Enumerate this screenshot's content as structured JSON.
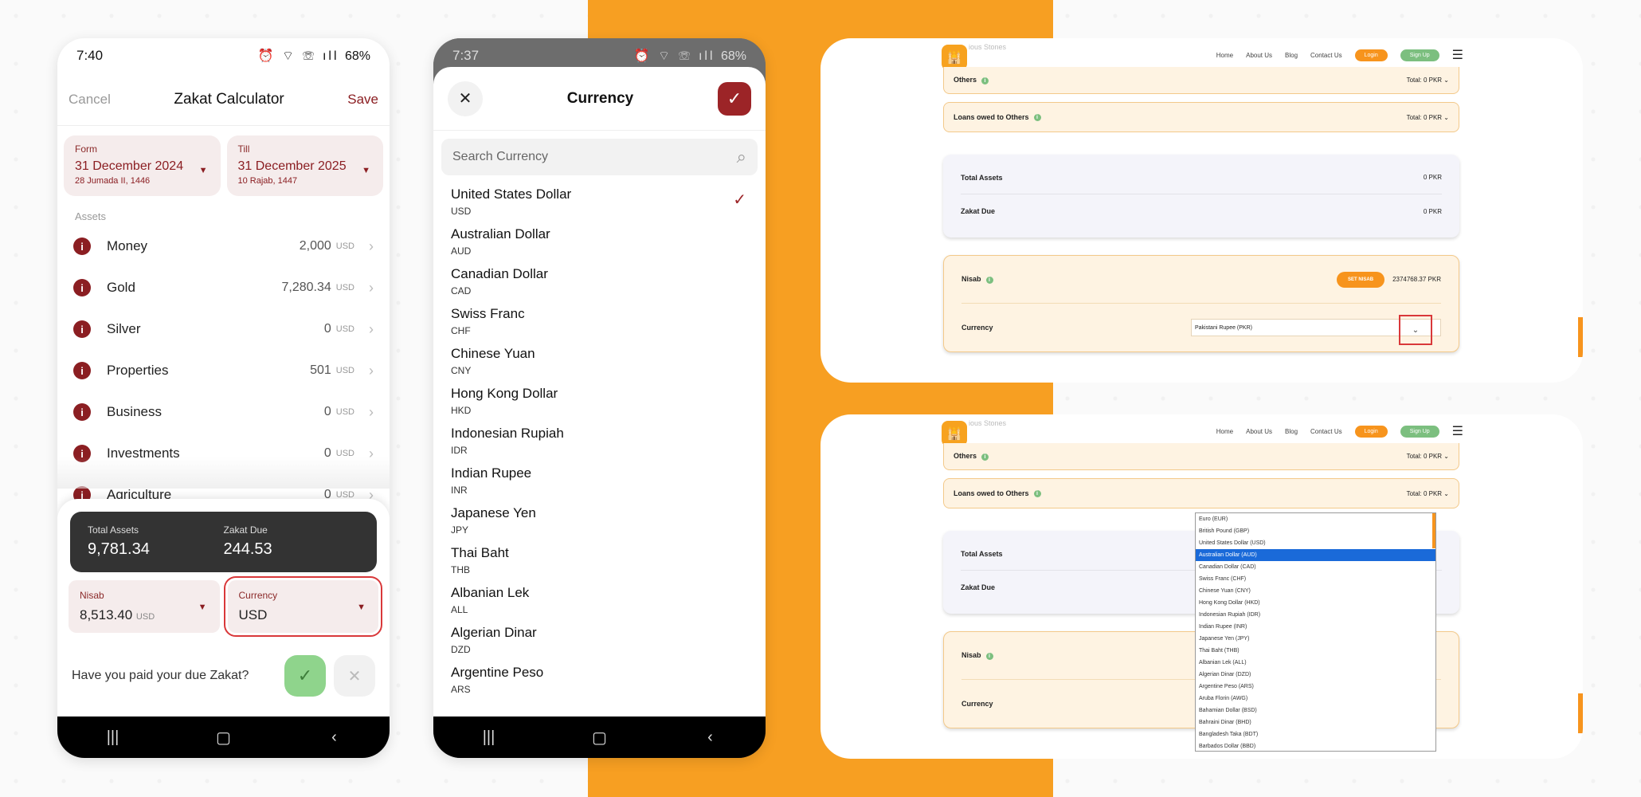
{
  "phone1": {
    "status": {
      "time": "7:40",
      "battery": "68%"
    },
    "header": {
      "cancel": "Cancel",
      "title": "Zakat Calculator",
      "save": "Save"
    },
    "from": {
      "label": "Form",
      "date": "31 December 2024",
      "hijri": "28 Jumada II, 1446"
    },
    "till": {
      "label": "Till",
      "date": "31 December 2025",
      "hijri": "10 Rajab, 1447"
    },
    "assets_label": "Assets",
    "assets": [
      {
        "name": "Money",
        "value": "2,000",
        "cur": "USD"
      },
      {
        "name": "Gold",
        "value": "7,280.34",
        "cur": "USD"
      },
      {
        "name": "Silver",
        "value": "0",
        "cur": "USD"
      },
      {
        "name": "Properties",
        "value": "501",
        "cur": "USD"
      },
      {
        "name": "Business",
        "value": "0",
        "cur": "USD"
      },
      {
        "name": "Investments",
        "value": "0",
        "cur": "USD"
      },
      {
        "name": "Agriculture",
        "value": "0",
        "cur": "USD"
      }
    ],
    "total_assets": {
      "label": "Total Assets",
      "value": "9,781.34"
    },
    "zakat_due": {
      "label": "Zakat Due",
      "value": "244.53"
    },
    "nisab": {
      "label": "Nisab",
      "value": "8,513.40",
      "cur": "USD"
    },
    "currency": {
      "label": "Currency",
      "value": "USD"
    },
    "question": "Have you paid your due Zakat?"
  },
  "phone2": {
    "status": {
      "time": "7:37",
      "battery": "68%"
    },
    "title": "Currency",
    "search_placeholder": "Search Currency",
    "currencies": [
      {
        "name": "United States Dollar",
        "code": "USD",
        "selected": true
      },
      {
        "name": "Australian Dollar",
        "code": "AUD"
      },
      {
        "name": "Canadian Dollar",
        "code": "CAD"
      },
      {
        "name": "Swiss Franc",
        "code": "CHF"
      },
      {
        "name": "Chinese Yuan",
        "code": "CNY"
      },
      {
        "name": "Hong Kong Dollar",
        "code": "HKD"
      },
      {
        "name": "Indonesian Rupiah",
        "code": "IDR"
      },
      {
        "name": "Indian Rupee",
        "code": "INR"
      },
      {
        "name": "Japanese Yen",
        "code": "JPY"
      },
      {
        "name": "Thai Baht",
        "code": "THB"
      },
      {
        "name": "Albanian Lek",
        "code": "ALL"
      },
      {
        "name": "Algerian Dinar",
        "code": "DZD"
      },
      {
        "name": "Argentine Peso",
        "code": "ARS"
      }
    ]
  },
  "web": {
    "ghost": "ious Stones",
    "nav": [
      "Home",
      "About Us",
      "Blog",
      "Contact Us"
    ],
    "login": "Login",
    "signup": "Sign Up",
    "others": "Others",
    "loans": "Loans owed to Others",
    "total_prefix": "Total:",
    "total_value": "0 PKR",
    "total_assets": "Total Assets",
    "zakat_due": "Zakat Due",
    "zero": "0 PKR",
    "nisab": "Nisab",
    "set_nisab": "SET NISAB",
    "nisab_value": "2374768.37 PKR",
    "currency": "Currency",
    "currency_value": "Pakistani Rupee (PKR)",
    "dropdown": [
      "Euro (EUR)",
      "British Pound (GBP)",
      "United States Dollar (USD)",
      "Australian Dollar (AUD)",
      "Canadian Dollar (CAD)",
      "Swiss Franc (CHF)",
      "Chinese Yuan (CNY)",
      "Hong Kong Dollar (HKD)",
      "Indonesian Rupiah (IDR)",
      "Indian Rupee (INR)",
      "Japanese Yen (JPY)",
      "Thai Baht (THB)",
      "Albanian Lek (ALL)",
      "Algerian Dinar (DZD)",
      "Argentine Peso (ARS)",
      "Aruba Florin (AWG)",
      "Bahamian Dollar (BSD)",
      "Bahraini Dinar (BHD)",
      "Bangladesh Taka (BDT)",
      "Barbados Dollar (BBD)"
    ],
    "dropdown_selected": 3
  },
  "colors": {
    "accent": "#8b1e22",
    "orange": "#f79f22",
    "green": "#7cbf7f"
  }
}
